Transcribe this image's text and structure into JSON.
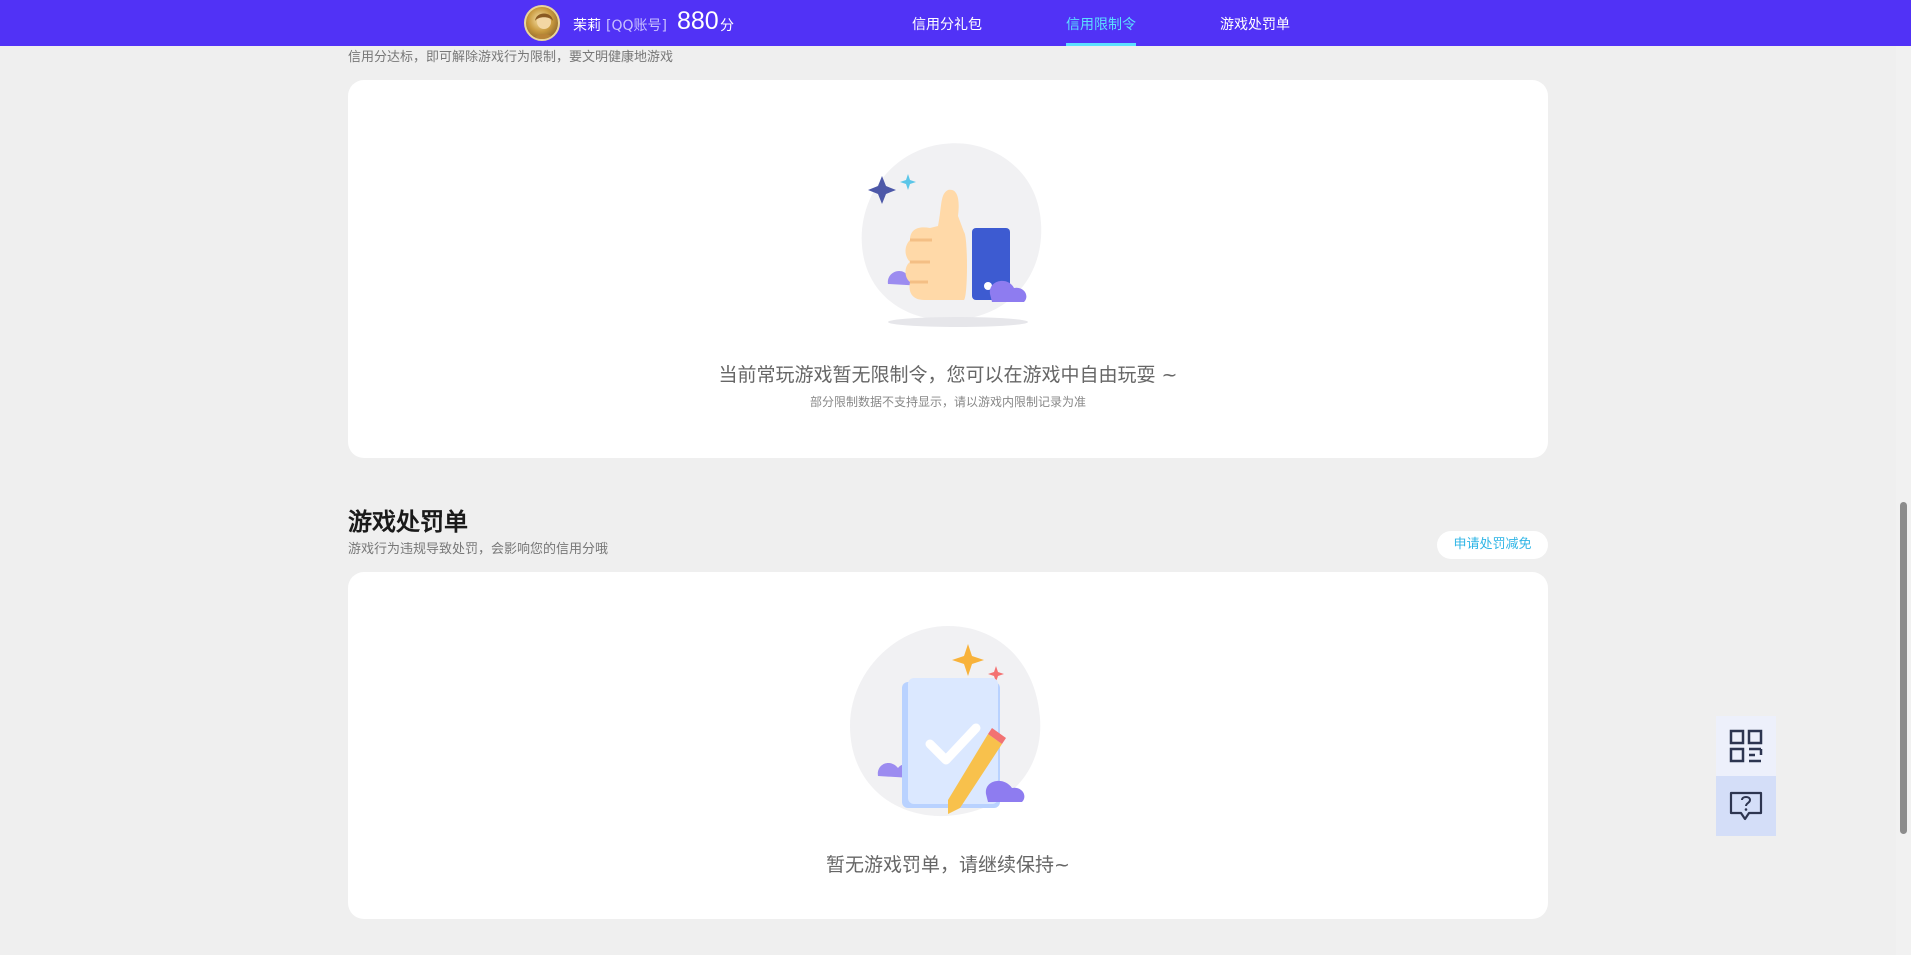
{
  "header": {
    "user_name": "茉莉",
    "account_type": "[QQ账号]",
    "score": "880",
    "score_unit": "分",
    "tabs": [
      {
        "label": "信用分礼包",
        "active": false
      },
      {
        "label": "信用限制令",
        "active": true
      },
      {
        "label": "游戏处罚单",
        "active": false
      }
    ]
  },
  "restriction": {
    "description": "信用分达标，即可解除游戏行为限制，要文明健康地游戏",
    "empty_text": "当前常玩游戏暂无限制令，您可以在游戏中自由玩耍 ~",
    "note": "部分限制数据不支持显示，请以游戏内限制记录为准"
  },
  "penalty": {
    "title": "游戏处罚单",
    "description": "游戏行为违规导致处罚，会影响您的信用分哦",
    "appeal_label": "申请处罚减免",
    "empty_text": "暂无游戏罚单，请继续保持~"
  },
  "side_tools": {
    "qr_icon": "qr-code-icon",
    "help_icon": "help-chat-icon"
  },
  "colors": {
    "brand": "#5132f6",
    "active_tab": "#5ce0ff",
    "link": "#2fb5e6",
    "background": "#efefef"
  }
}
